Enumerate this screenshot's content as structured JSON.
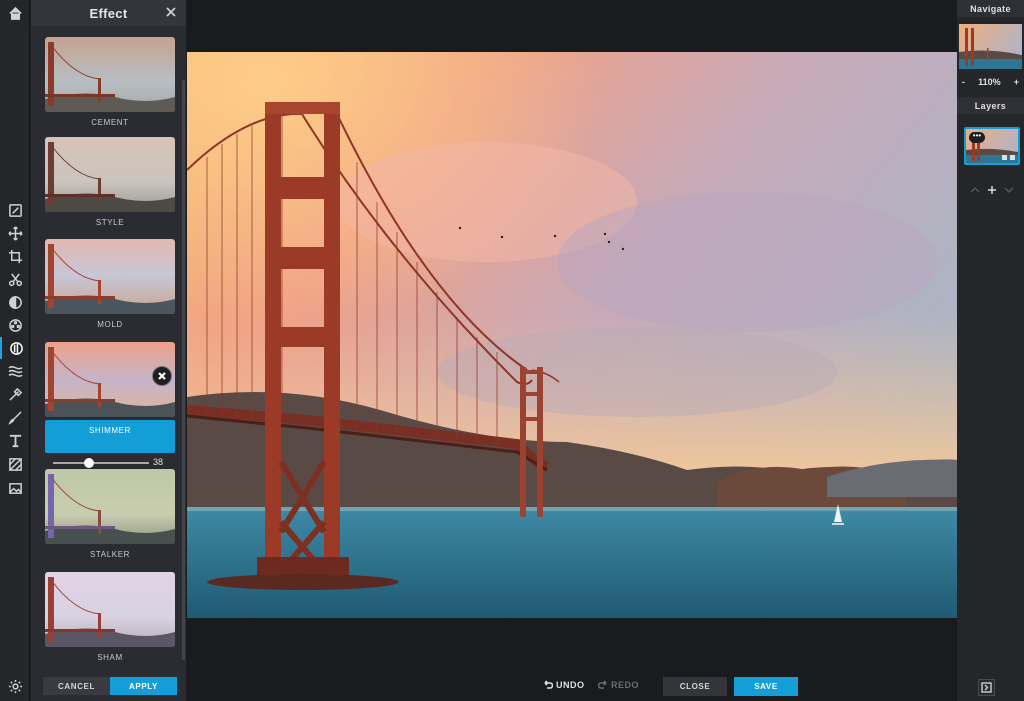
{
  "panel": {
    "title": "Effect",
    "effects": [
      {
        "label": "CEMENT"
      },
      {
        "label": "STYLE"
      },
      {
        "label": "MOLD"
      },
      {
        "label": "SHIMMER"
      },
      {
        "label": "STALKER"
      },
      {
        "label": "SHAM"
      }
    ],
    "selected_effect": "SHIMMER",
    "intensity_value": "38",
    "intensity_fraction": 0.38,
    "cancel_label": "CANCEL",
    "apply_label": "APPLY"
  },
  "bottom": {
    "undo_label": "UNDO",
    "redo_label": "REDO",
    "close_label": "CLOSE",
    "save_label": "SAVE"
  },
  "right": {
    "navigate_title": "Navigate",
    "zoom_out": "-",
    "zoom_level": "110%",
    "zoom_in": "+",
    "layers_title": "Layers",
    "layer_badge": "•••"
  },
  "toolbar": {
    "icons": [
      "home-icon",
      "adjust-icon",
      "move-icon",
      "crop-icon",
      "cut-icon",
      "exposure-icon",
      "color-icon",
      "effect-icon",
      "liquify-icon",
      "touchup-icon",
      "brush-icon",
      "text-icon",
      "pattern-icon",
      "image-icon",
      "settings-icon"
    ]
  },
  "colors": {
    "accent": "#139ed8",
    "background": "#1d1e22",
    "panel": "#2b2c31"
  }
}
